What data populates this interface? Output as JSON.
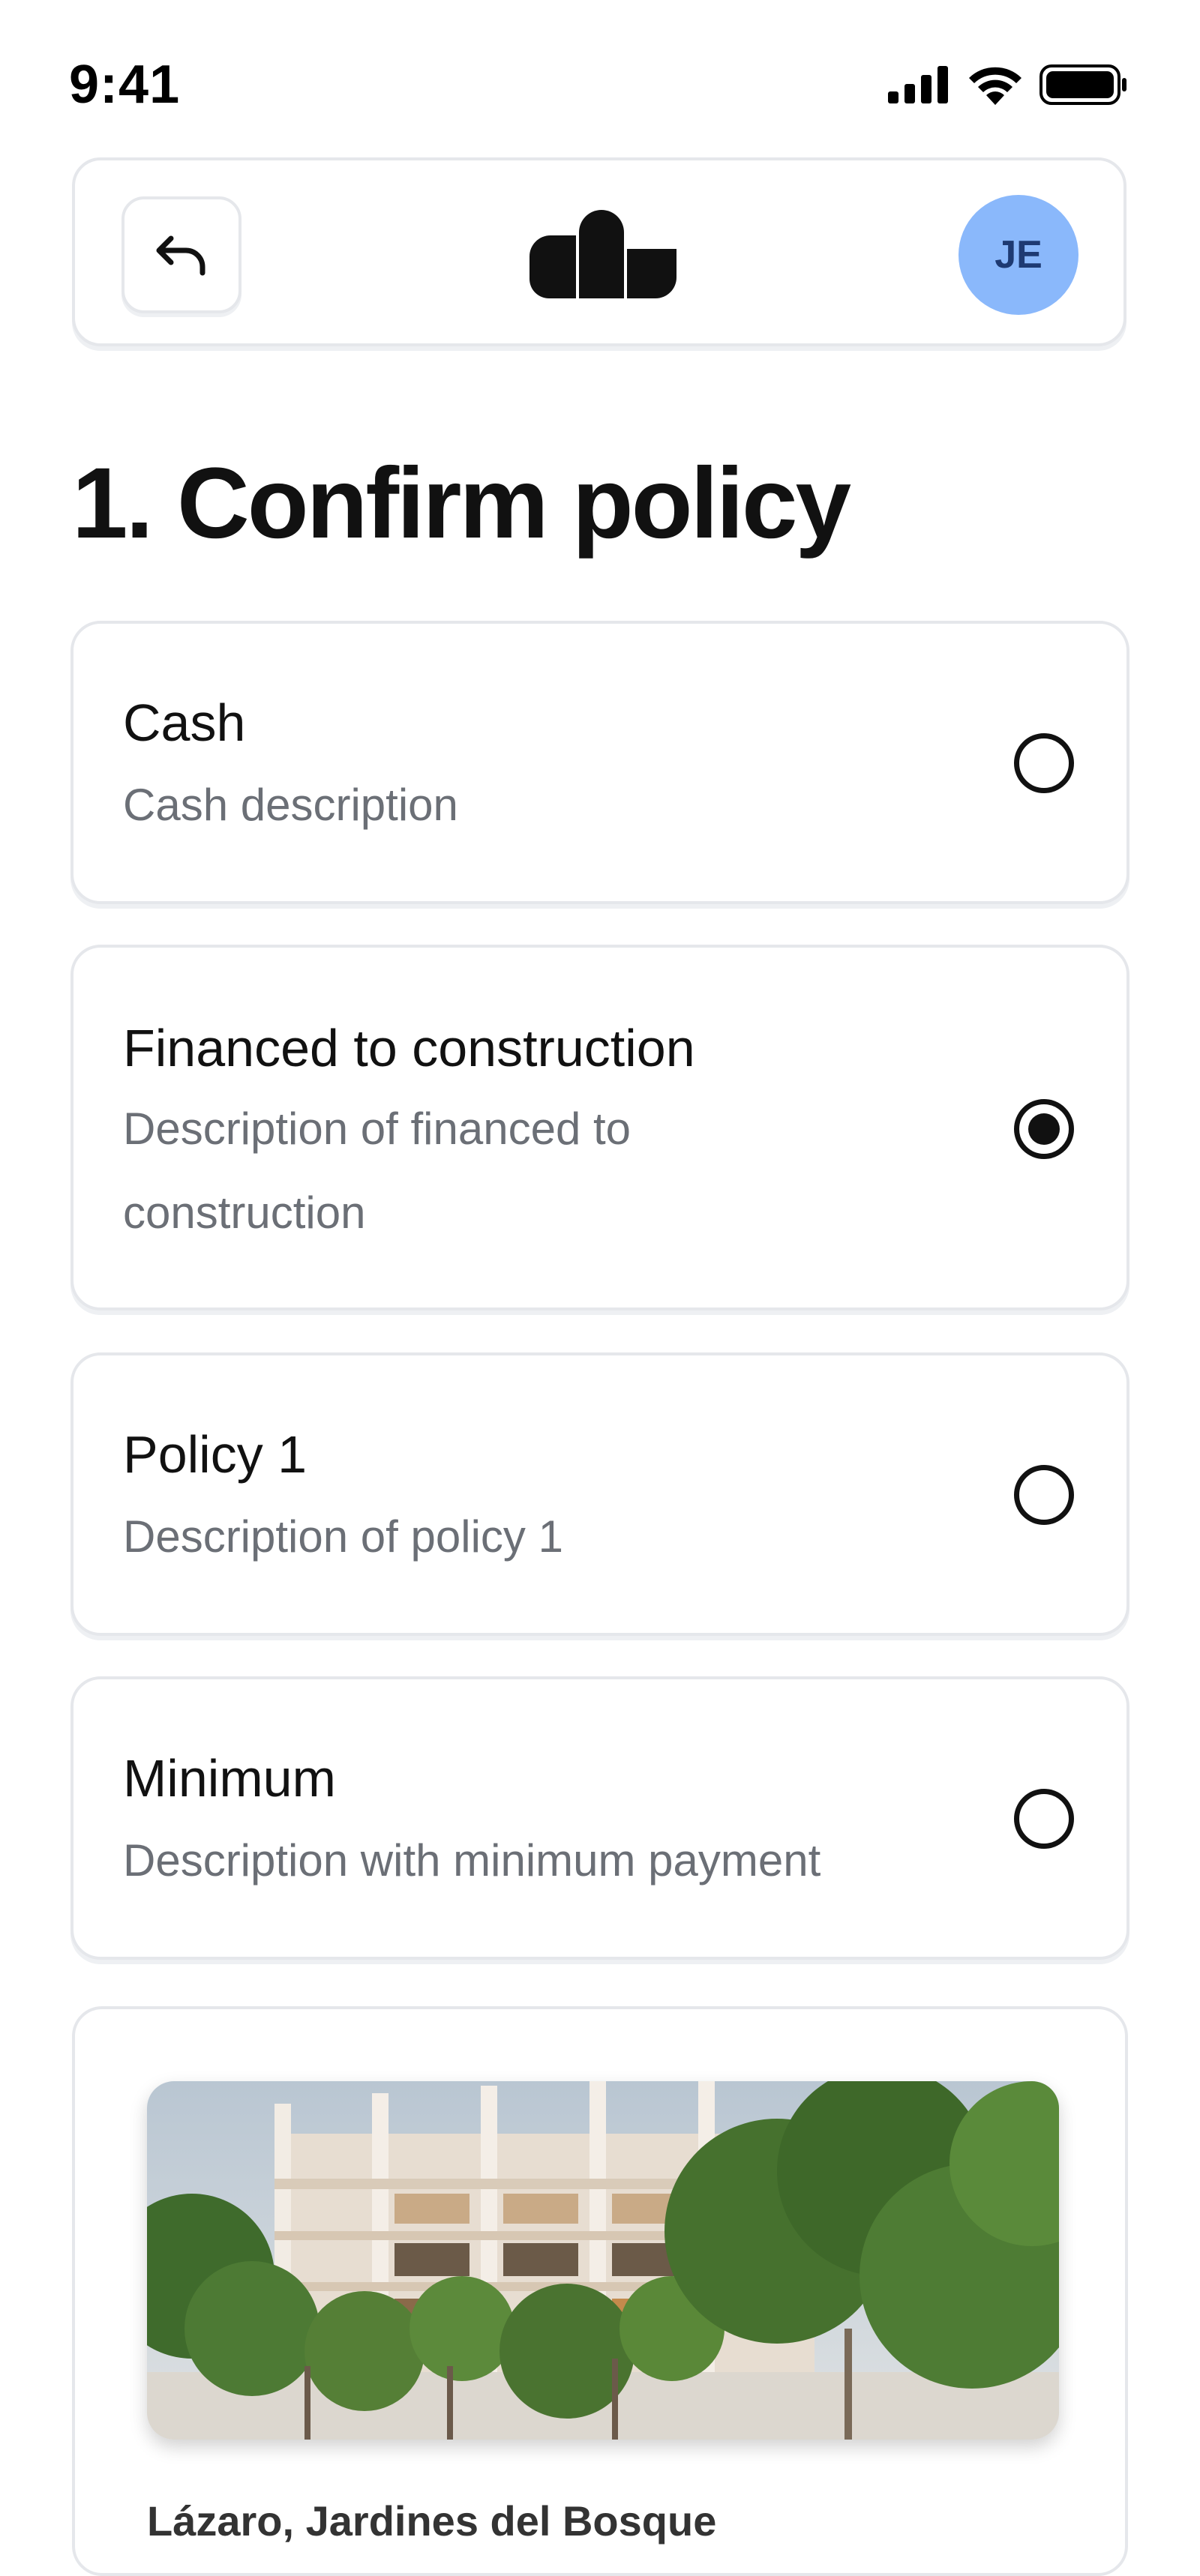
{
  "status_bar": {
    "time": "9:41",
    "icons": [
      "cellular-signal-icon",
      "wifi-icon",
      "battery-icon"
    ]
  },
  "header": {
    "back_icon": "undo-arrow-icon",
    "logo": "brand-logo",
    "avatar_initials": "JE",
    "avatar_color": "#8ab8fb"
  },
  "page": {
    "title": "1. Confirm policy"
  },
  "policies": [
    {
      "title": "Cash",
      "description": "Cash description",
      "selected": false
    },
    {
      "title": "Financed to construction",
      "description": "Description of financed to construction",
      "selected": true
    },
    {
      "title": "Policy 1",
      "description": "Description of policy 1",
      "selected": false
    },
    {
      "title": "Minimum",
      "description": "Description with minimum payment",
      "selected": false
    }
  ],
  "property": {
    "image": "building-photo",
    "name": "Lázaro, Jardines del Bosque"
  }
}
